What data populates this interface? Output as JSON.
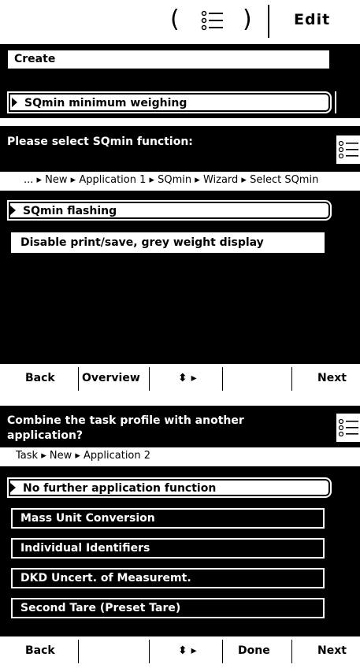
{
  "topbar": {
    "open_paren": "(",
    "close_paren": ")",
    "list_icon": "list-icon",
    "edit_label": "Edit"
  },
  "panel1": {
    "create_label": "Create",
    "selected_label": "SQmin minimum weighing"
  },
  "panel2": {
    "title": "Please select SQmin function:",
    "menu_icon": "menu-list-icon",
    "breadcrumb": "... ▸ New ▸ Application 1 ▸ SQmin ▸ Wizard ▸ Select SQmin",
    "items": [
      "SQmin flashing",
      "Disable print/save, grey weight display"
    ],
    "softkeys": {
      "back": "Back",
      "overview": "Overview",
      "arrows": "⬍ ▸",
      "empty": "",
      "next": "Next"
    }
  },
  "panel3": {
    "title": "Combine the task profile with another application?",
    "menu_icon": "menu-list-icon",
    "breadcrumb": "Task ▸ New ▸ Application 2",
    "items": [
      "No further application function",
      "Mass Unit Conversion",
      "Individual Identifiers",
      "DKD Uncert. of Measuremt.",
      "Second Tare (Preset Tare)"
    ],
    "softkeys": {
      "back": "Back",
      "empty": "",
      "arrows": "⬍ ▸",
      "done": "Done",
      "next": "Next"
    }
  },
  "colors": {
    "background": "#000000",
    "foreground": "#ffffff"
  }
}
